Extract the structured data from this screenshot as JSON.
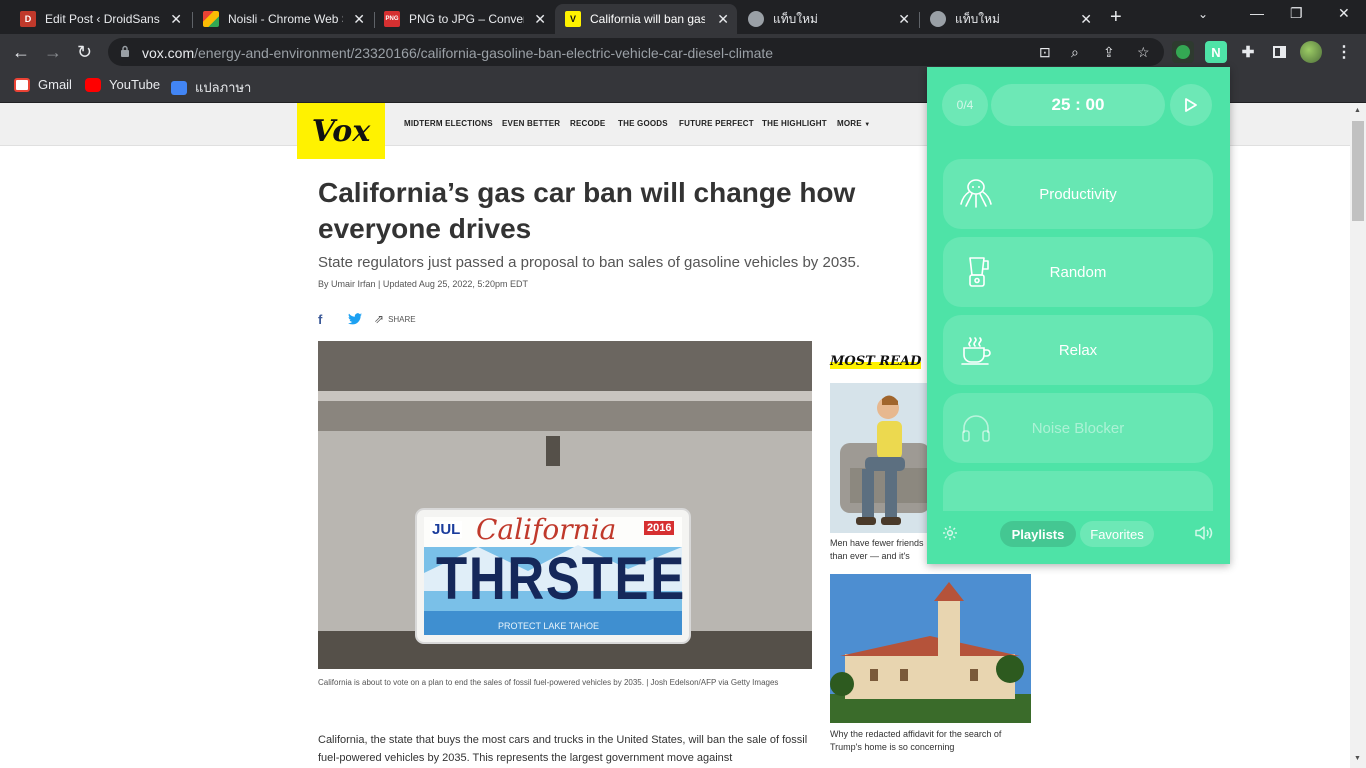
{
  "browser": {
    "tabs": [
      {
        "title": "Edit Post ‹ DroidSans –",
        "favicon": "droidsans-icon",
        "color": "#c0392b",
        "active": false
      },
      {
        "title": "Noisli - Chrome Web S",
        "favicon": "chrome-web-store-icon",
        "color": "#4285f4",
        "active": false
      },
      {
        "title": "PNG to JPG – Convert",
        "favicon": "png-to-jpg-icon",
        "color": "#d63031",
        "active": false
      },
      {
        "title": "California will ban gas",
        "favicon": "vox-favicon-icon",
        "color": "#fff200",
        "active": true
      },
      {
        "title": "แท็บใหม่",
        "favicon": "chrome-icon",
        "color": "#9aa0a6",
        "active": false
      },
      {
        "title": "แท็บใหม่",
        "favicon": "chrome-icon",
        "color": "#9aa0a6",
        "active": false
      }
    ],
    "url_host": "vox.com",
    "url_path": "/energy-and-environment/23320166/california-gasoline-ban-electric-vehicle-car-diesel-climate",
    "bookmarks": [
      {
        "label": "Gmail",
        "icon": "gmail-icon",
        "color": "#ea4335"
      },
      {
        "label": "YouTube",
        "icon": "youtube-icon",
        "color": "#ff0000"
      },
      {
        "label": "แปลภาษา",
        "icon": "translate-icon",
        "color": "#4285f4"
      }
    ]
  },
  "vox": {
    "logo": "Vox",
    "nav": [
      "MIDTERM ELECTIONS",
      "EVEN BETTER",
      "RECODE",
      "THE GOODS",
      "FUTURE PERFECT",
      "THE HIGHLIGHT",
      "MORE"
    ],
    "headline": "California’s gas car ban will change how everyone drives",
    "dek": "State regulators just passed a proposal to ban sales of gasoline vehicles by 2035.",
    "byline": "By Umair Irfan  |  Updated Aug 25, 2022, 5:20pm EDT",
    "share_label": "SHARE",
    "plate": {
      "month": "JUL",
      "state": "California",
      "year": "2016",
      "number": "THRSTEE",
      "slogan": "PROTECT LAKE TAHOE"
    },
    "caption": "California is about to vote on a plan to end the sales of fossil fuel-powered vehicles by 2035.  |  Josh Edelson/AFP via Getty Images",
    "body": "California, the state that buys the most cars and trucks in the United States, will ban the sale of fossil fuel-powered vehicles by 2035. This represents the largest government move against",
    "most_read_title": "MOST READ",
    "most_read": [
      {
        "caption": "Men have fewer friends than ever — and it's harming their health"
      },
      {
        "caption": "Why the redacted affidavit for the search of Trump's home is so concerning"
      }
    ]
  },
  "noisli": {
    "counter": "0/4",
    "timer": "25 : 00",
    "cards": [
      {
        "label": "Productivity",
        "icon": "octopus-icon",
        "dim": false
      },
      {
        "label": "Random",
        "icon": "blender-icon",
        "dim": false
      },
      {
        "label": "Relax",
        "icon": "coffee-cup-icon",
        "dim": false
      },
      {
        "label": "Noise Blocker",
        "icon": "headphones-icon",
        "dim": true
      }
    ],
    "footer_tabs": [
      "Playlists",
      "Favorites"
    ],
    "active_footer_tab": "Playlists"
  }
}
